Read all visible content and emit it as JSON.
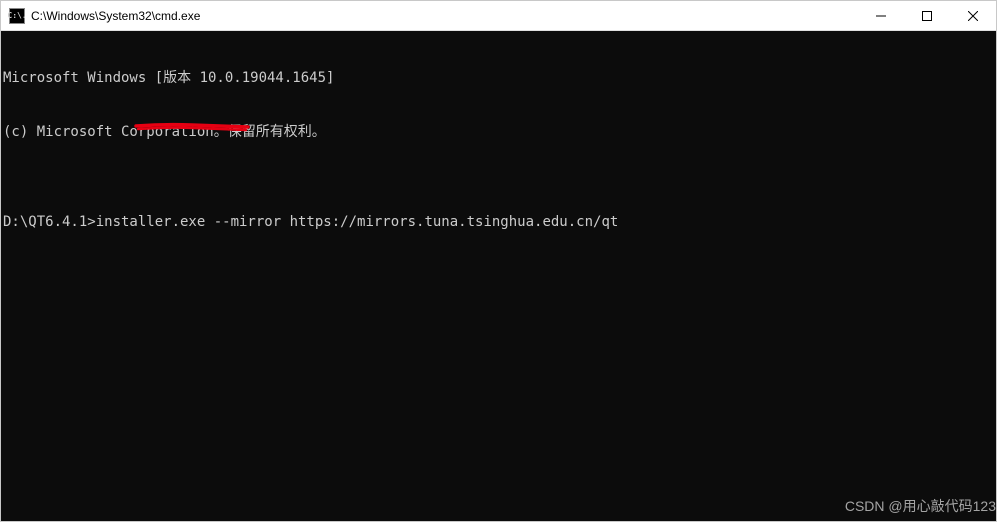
{
  "window": {
    "title": "C:\\Windows\\System32\\cmd.exe",
    "icon_label": "C:\\."
  },
  "terminal": {
    "line1": "Microsoft Windows [版本 10.0.19044.1645]",
    "line2": "(c) Microsoft Corporation。保留所有权利。",
    "line3": "",
    "prompt": "D:\\QT6.4.1>",
    "command": "installer.exe --mirror https://mirrors.tuna.tsinghua.edu.cn/qt"
  },
  "annotation": {
    "underline_color": "#e60012"
  },
  "watermark": "CSDN @用心敲代码123"
}
